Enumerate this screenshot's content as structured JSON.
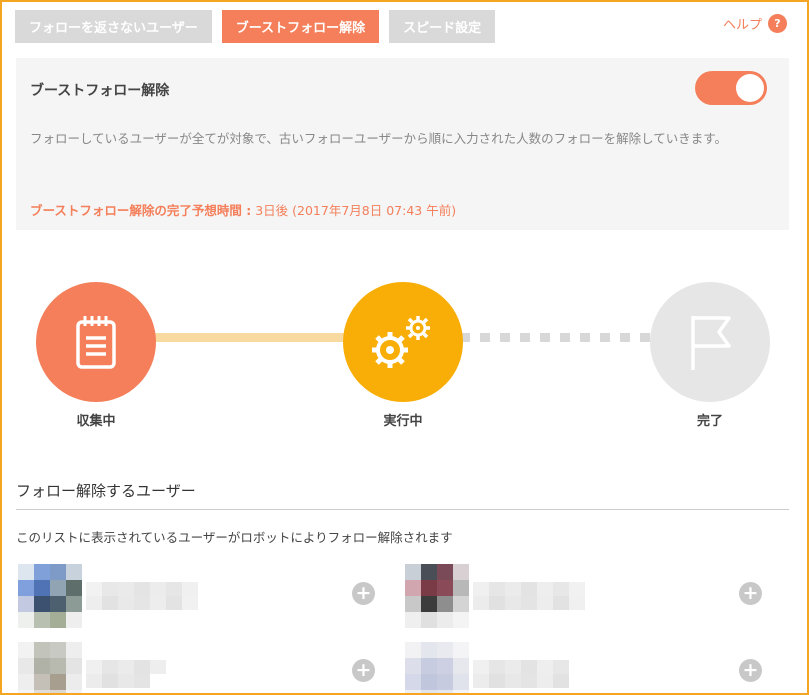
{
  "tabs": [
    {
      "label": "フォローを返さないユーザー",
      "active": false
    },
    {
      "label": "ブーストフォロー解除",
      "active": true
    },
    {
      "label": "スピード設定",
      "active": false
    }
  ],
  "help": {
    "label": "ヘルプ",
    "badge": "?"
  },
  "panel": {
    "title": "ブーストフォロー解除",
    "toggle_on": true,
    "description": "フォローしているユーザーが全てが対象で、古いフォローユーザーから順に入力された人数のフォローを解除していきます。",
    "eta_label": "ブーストフォロー解除の完了予想時間 :",
    "eta_value": " 3日後 (2017年7月8日 07:43 午前)"
  },
  "steps": [
    {
      "label": "収集中",
      "icon": "notepad-icon",
      "color": "#f47f5a",
      "state": "done"
    },
    {
      "label": "実行中",
      "icon": "gears-icon",
      "color": "#f8ae06",
      "state": "active"
    },
    {
      "label": "完了",
      "icon": "flag-icon",
      "color": "#e6e6e6",
      "state": "pending"
    }
  ],
  "users": {
    "title": "フォロー解除するユーザー",
    "note": "このリストに表示されているユーザーがロボットによりフォロー解除されます",
    "add_icon": "plus-circle-icon"
  },
  "colors": {
    "accent": "#f47f5a",
    "running": "#f8ae06",
    "inactive": "#d9d9d9",
    "frame": "#f4a623"
  }
}
